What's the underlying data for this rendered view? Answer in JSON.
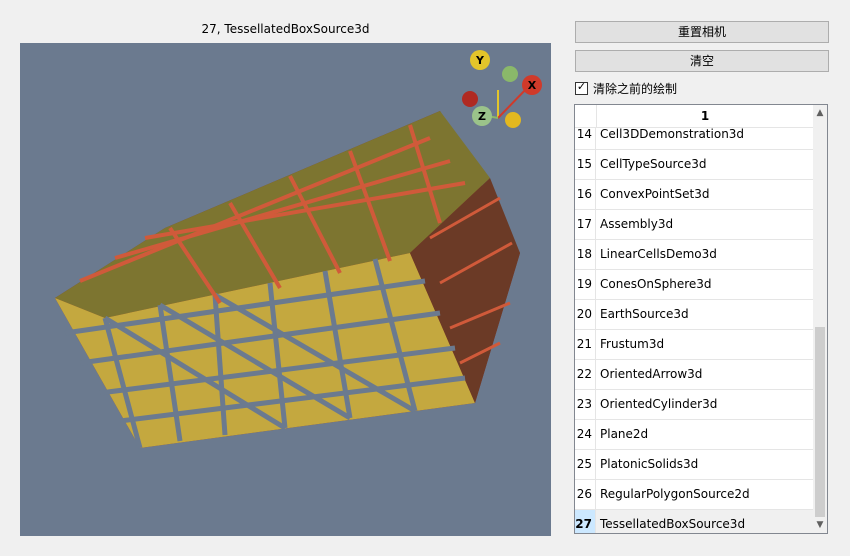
{
  "viewport": {
    "title": "27, TessellatedBoxSource3d",
    "background": "#6b7a8f",
    "orientation_axes": {
      "x_label": "X",
      "y_label": "Y",
      "z_label": "Z"
    }
  },
  "controls": {
    "reset_camera_label": "重置相机",
    "clear_label": "清空",
    "clear_previous_label": "清除之前的绘制",
    "clear_previous_checked": true
  },
  "table": {
    "column_header": "1",
    "rows": [
      {
        "num": "14",
        "name": "Cell3DDemonstration3d"
      },
      {
        "num": "15",
        "name": "CellTypeSource3d"
      },
      {
        "num": "16",
        "name": "ConvexPointSet3d"
      },
      {
        "num": "17",
        "name": "Assembly3d"
      },
      {
        "num": "18",
        "name": "LinearCellsDemo3d"
      },
      {
        "num": "19",
        "name": "ConesOnSphere3d"
      },
      {
        "num": "20",
        "name": "EarthSource3d"
      },
      {
        "num": "21",
        "name": "Frustum3d"
      },
      {
        "num": "22",
        "name": "OrientedArrow3d"
      },
      {
        "num": "23",
        "name": "OrientedCylinder3d"
      },
      {
        "num": "24",
        "name": "Plane2d"
      },
      {
        "num": "25",
        "name": "PlatonicSolids3d"
      },
      {
        "num": "26",
        "name": "RegularPolygonSource2d"
      },
      {
        "num": "27",
        "name": "TessellatedBoxSource3d"
      }
    ],
    "selected_num": "27",
    "scroll_up_icon": "▲",
    "scroll_down_icon": "▼"
  }
}
